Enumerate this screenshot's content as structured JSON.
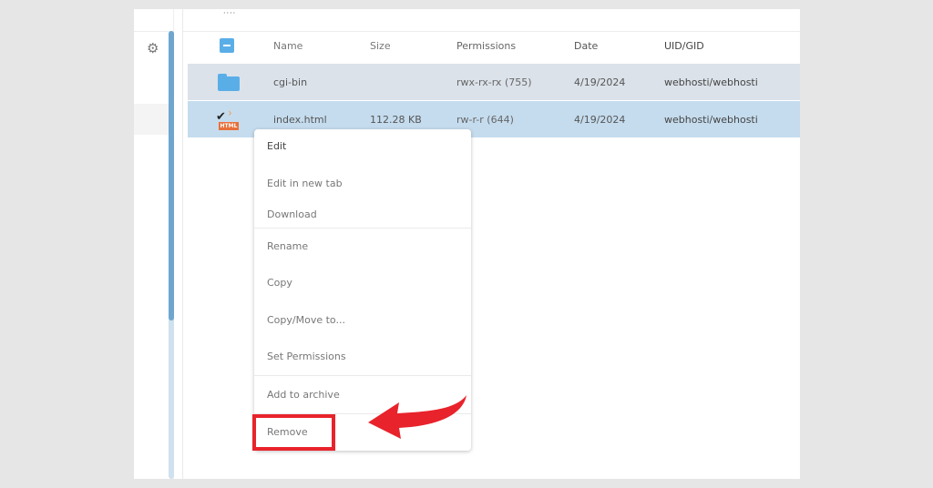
{
  "sidebar": {
    "settings_icon": "gear-icon"
  },
  "table": {
    "select_all_state": "indeterminate",
    "columns": [
      "Name",
      "Size",
      "Permissions",
      "Date",
      "UID/GID"
    ],
    "rows": [
      {
        "icon": "folder-icon",
        "name": "cgi-bin",
        "size": "",
        "permissions": "rwx-rx-rx (755)",
        "date": "4/19/2024",
        "uid_gid": "webhosti/webhosti"
      },
      {
        "icon": "html-file-icon",
        "name": "index.html",
        "size": "112.28 KB",
        "permissions": "rw-r-r (644)",
        "date": "4/19/2024",
        "uid_gid": "webhosti/webhosti"
      }
    ]
  },
  "context_menu": {
    "items": [
      "Edit",
      "Edit in new tab",
      "Download",
      "Rename",
      "Copy",
      "Copy/Move to...",
      "Set Permissions",
      "Add to archive",
      "Remove"
    ]
  },
  "annotation": {
    "highlight_color": "#e8232b",
    "highlighted_item": "Remove"
  },
  "colors": {
    "accent": "#5aaee8",
    "row_selected": "#c5dcee",
    "row_hover": "#dbe2ea"
  }
}
